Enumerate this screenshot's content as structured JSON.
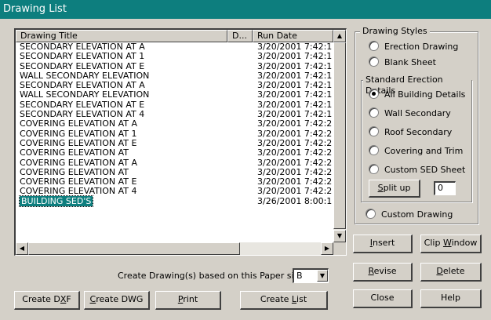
{
  "window": {
    "title": "Drawing List"
  },
  "list": {
    "columns": [
      "Drawing Title",
      "D...",
      "Run Date"
    ],
    "rows": [
      {
        "title": "SECONDARY ELEVATION AT A",
        "date": "3/20/2001  7:42:1"
      },
      {
        "title": "SECONDARY ELEVATION AT 1",
        "date": "3/20/2001  7:42:1"
      },
      {
        "title": "SECONDARY ELEVATION AT E",
        "date": "3/20/2001  7:42:1"
      },
      {
        "title": "WALL SECONDARY ELEVATION",
        "date": "3/20/2001  7:42:1"
      },
      {
        "title": "SECONDARY ELEVATION AT A",
        "date": "3/20/2001  7:42:1"
      },
      {
        "title": "WALL SECONDARY ELEVATION",
        "date": "3/20/2001  7:42:1"
      },
      {
        "title": "SECONDARY ELEVATION AT E",
        "date": "3/20/2001  7:42:1"
      },
      {
        "title": "SECONDARY ELEVATION AT 4",
        "date": "3/20/2001  7:42:1"
      },
      {
        "title": "COVERING ELEVATION AT A",
        "date": "3/20/2001  7:42:2"
      },
      {
        "title": "COVERING ELEVATION AT 1",
        "date": "3/20/2001  7:42:2"
      },
      {
        "title": "COVERING ELEVATION AT E",
        "date": "3/20/2001  7:42:2"
      },
      {
        "title": "COVERING ELEVATION AT",
        "date": "3/20/2001  7:42:2"
      },
      {
        "title": "COVERING ELEVATION AT A",
        "date": "3/20/2001  7:42:2"
      },
      {
        "title": "COVERING ELEVATION AT",
        "date": "3/20/2001  7:42:2"
      },
      {
        "title": "COVERING ELEVATION AT E",
        "date": "3/20/2001  7:42:2"
      },
      {
        "title": "COVERING ELEVATION AT 4",
        "date": "3/20/2001  7:42:2"
      },
      {
        "title": "BUILDING SED'S",
        "date": "3/26/2001  8:00:1",
        "selected": true
      }
    ]
  },
  "paper": {
    "label": "Create Drawing(s) based on this Paper size",
    "value": "B"
  },
  "buttons": {
    "create_dxf": {
      "pre": "Create D",
      "key": "X",
      "post": "F"
    },
    "create_dwg": {
      "pre": "",
      "key": "C",
      "post": "reate DWG"
    },
    "print": {
      "pre": "",
      "key": "P",
      "post": "rint"
    },
    "create_list": {
      "pre": "Create ",
      "key": "L",
      "post": "ist"
    },
    "insert": {
      "pre": "",
      "key": "I",
      "post": "nsert"
    },
    "clip_window": {
      "pre": "Clip ",
      "key": "W",
      "post": "indow"
    },
    "revise": {
      "pre": "",
      "key": "R",
      "post": "evise"
    },
    "delete": {
      "pre": "",
      "key": "D",
      "post": "elete"
    },
    "close": {
      "label": "Close"
    },
    "help": {
      "label": "Help"
    },
    "split_up": {
      "pre": "",
      "key": "S",
      "post": "plit up"
    }
  },
  "drawing_styles": {
    "legend": "Drawing Styles",
    "erection": "Erection Drawing",
    "blank": "Blank Sheet",
    "custom": "Custom Drawing"
  },
  "sed": {
    "legend": "Standard Erection Details",
    "options": [
      "All Building Details",
      "Wall Secondary",
      "Roof Secondary",
      "Covering and Trim",
      "Custom SED Sheet"
    ],
    "selected_index": 0,
    "split_value": "0"
  },
  "colors": {
    "title_bar": "#0d7e7e",
    "selection": "#0d7e7e",
    "face": "#d4d0c8"
  }
}
